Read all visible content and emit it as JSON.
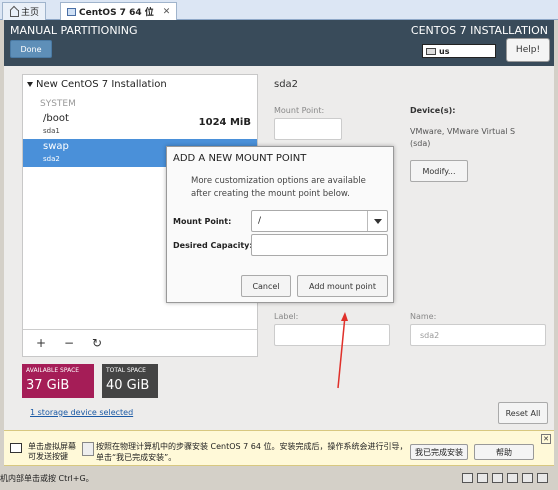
{
  "vm_tabs": [
    {
      "label": "主页"
    },
    {
      "label": "CentOS 7 64 位"
    }
  ],
  "header": {
    "title": "MANUAL PARTITIONING",
    "done_label": "Done",
    "installer_title": "CENTOS 7 INSTALLATION",
    "keyboard_layout": "us",
    "help_label": "Help!"
  },
  "left_panel": {
    "installation_label": "New CentOS 7 Installation",
    "system_label": "SYSTEM",
    "partitions": [
      {
        "mount": "/boot",
        "device": "sda1",
        "size": "1024 MiB"
      },
      {
        "mount": "swap",
        "device": "sda2",
        "size": ""
      }
    ],
    "buttons": [
      "+",
      "−",
      "↻"
    ]
  },
  "space": {
    "available_label": "AVAILABLE SPACE",
    "available_value": "37 GiB",
    "total_label": "TOTAL SPACE",
    "total_value": "40 GiB",
    "storage_link": "1 storage device selected",
    "reset_label": "Reset All"
  },
  "right_panel": {
    "title": "sda2",
    "mount_point_label": "Mount Point:",
    "devices_label": "Device(s):",
    "devices_text_1": "VMware, VMware Virtual S",
    "devices_text_2": "(sda)",
    "modify_label": "Modify...",
    "label_label": "Label:",
    "name_label": "Name:",
    "name_value": "sda2"
  },
  "dialog": {
    "title": "ADD A NEW MOUNT POINT",
    "description_1": "More customization options are available",
    "description_2": "after creating the mount point below.",
    "mount_point_label": "Mount Point:",
    "mount_point_value": "/",
    "capacity_label": "Desired Capacity:",
    "capacity_value": "",
    "cancel_label": "Cancel",
    "add_label": "Add mount point"
  },
  "hint_bar": {
    "left_line_1": "单击虚拟屏幕",
    "left_line_2": "可发送按键",
    "message": "按照在物理计算机中的步骤安装 CentOS 7 64 位。安装完成后，操作系统会进行引导，单击“我已完成安装”。",
    "done_install_label": "我已完成安装",
    "help_label": "帮助"
  },
  "status_bar": {
    "text": "机内部单击或按 Ctrl+G。"
  },
  "colors": {
    "header": "#394b5a",
    "selected_row": "#4a90d9",
    "available": "#a51d57",
    "annotation_arrow": "#e0302a"
  }
}
